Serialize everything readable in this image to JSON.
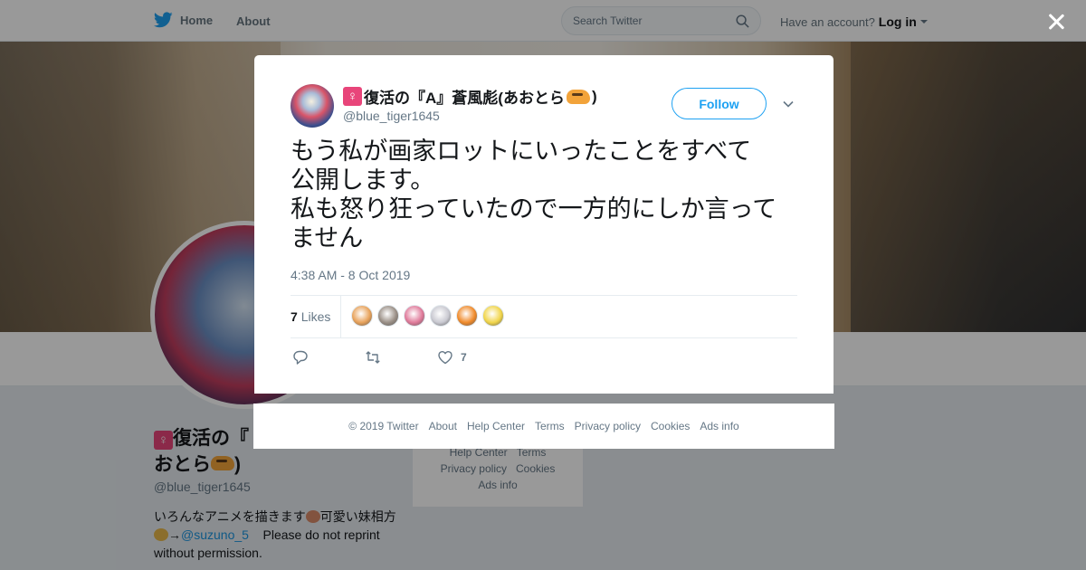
{
  "topbar": {
    "home_label": "Home",
    "about_label": "About",
    "search_placeholder": "Search Twitter",
    "account_prompt": "Have an account?",
    "login_label": "Log in"
  },
  "profile": {
    "name_line1": "復活の『",
    "name_line2": "おとら",
    "name_close": ")",
    "handle": "@blue_tiger1645",
    "bio_part1": "いろんなアニメを描きます",
    "bio_part2": "可愛い妹相方",
    "bio_mention": "@suzuno_5",
    "bio_part3": "Please do not reprint without permission.",
    "side_links": [
      "Help Center",
      "Terms",
      "Privacy policy",
      "Cookies",
      "Ads info"
    ]
  },
  "tweet": {
    "display_name": "復活の『A』蒼風彪(あおとら",
    "name_close": ")",
    "female_symbol": "♀",
    "handle": "@blue_tiger1645",
    "follow_label": "Follow",
    "text_line1": "もう私が画家ロットにいったことをすべて",
    "text_line2": "公開します。",
    "text_line3": "私も怒り狂っていたので一方的にしか言って",
    "text_line4": "ません",
    "timestamp": "4:38 AM - 8 Oct 2019",
    "likes_count": "7",
    "likes_label": "Likes",
    "like_action_count": "7",
    "liker_colors": [
      "#e8a25a",
      "#9a8f86",
      "#e07a9a",
      "#c9c9d1",
      "#f08a2a",
      "#f1d54a"
    ]
  },
  "footer": {
    "links": [
      "© 2019 Twitter",
      "About",
      "Help Center",
      "Terms",
      "Privacy policy",
      "Cookies",
      "Ads info"
    ]
  },
  "colors": {
    "accent": "#1da1f2",
    "text_secondary": "#657786"
  }
}
